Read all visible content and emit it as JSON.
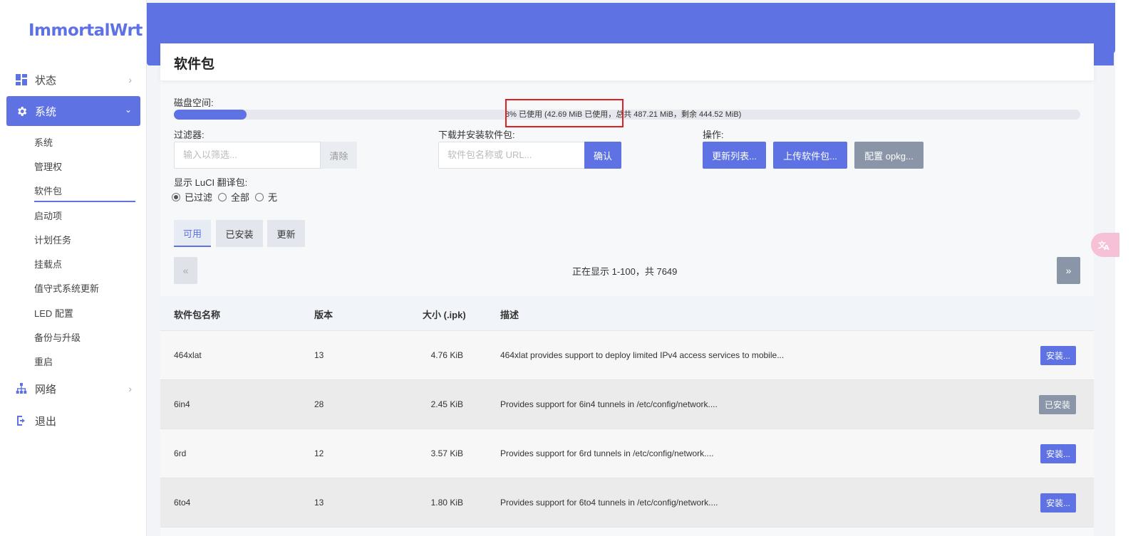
{
  "brand": "ImmortalWrt",
  "colors": {
    "accent": "#5e72e4",
    "grey_button": "#8a96a8",
    "highlight": "#e02020"
  },
  "nav": {
    "status": {
      "label": "状态",
      "icon": "dashboard-icon"
    },
    "system": {
      "label": "系统",
      "icon": "gear-icon"
    },
    "network": {
      "label": "网络",
      "icon": "network-icon"
    },
    "logout": {
      "label": "退出",
      "icon": "logout-icon"
    },
    "sub": [
      "系统",
      "管理权",
      "软件包",
      "启动项",
      "计划任务",
      "挂载点",
      "值守式系统更新",
      "LED 配置",
      "备份与升级",
      "重启"
    ]
  },
  "page": {
    "title": "软件包",
    "disk_label": "磁盘空间:",
    "disk_text": "8% 已使用 (42.69 MiB 已使用，总共 487.21 MiB，剩余 444.52 MiB)",
    "disk_used_fraction": 0.08,
    "filter_label": "过滤器:",
    "filter_placeholder": "输入以筛选...",
    "filter_clear": "清除",
    "download_label": "下载并安装软件包:",
    "download_placeholder": "软件包名称或 URL...",
    "download_confirm": "确认",
    "actions_label": "操作:",
    "btn_update_list": "更新列表...",
    "btn_upload": "上传软件包...",
    "btn_config": "配置 opkg...",
    "luci_label": "显示 LuCI 翻译包:",
    "radio": [
      "已过滤",
      "全部",
      "无"
    ],
    "tabs": [
      "可用",
      "已安装",
      "更新"
    ],
    "pager_prev": "«",
    "pager_next": "»",
    "pager_text": "正在显示 1-100，共 7649"
  },
  "table": {
    "headers": [
      "软件包名称",
      "版本",
      "大小 (.ipk)",
      "描述"
    ],
    "rows": [
      {
        "name": "464xlat",
        "version": "13",
        "size": "4.76 KiB",
        "desc": "464xlat provides support to deploy limited IPv4 access services to mobile...",
        "action": "安装..."
      },
      {
        "name": "6in4",
        "version": "28",
        "size": "2.45 KiB",
        "desc": "Provides support for 6in4 tunnels in /etc/config/network....",
        "action": "已安装"
      },
      {
        "name": "6rd",
        "version": "12",
        "size": "3.57 KiB",
        "desc": "Provides support for 6rd tunnels in /etc/config/network....",
        "action": "安装..."
      },
      {
        "name": "6to4",
        "version": "13",
        "size": "1.80 KiB",
        "desc": "Provides support for 6to4 tunnels in /etc/config/network....",
        "action": "安装..."
      }
    ]
  },
  "translate_icon": "translate-icon"
}
